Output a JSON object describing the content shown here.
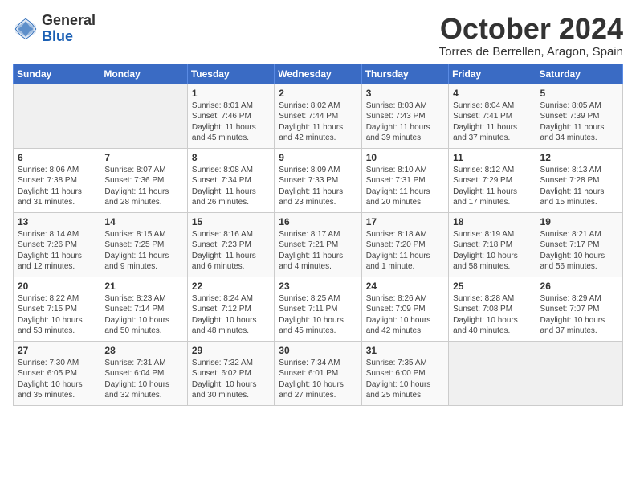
{
  "header": {
    "logo_general": "General",
    "logo_blue": "Blue",
    "month_title": "October 2024",
    "location": "Torres de Berrellen, Aragon, Spain"
  },
  "weekdays": [
    "Sunday",
    "Monday",
    "Tuesday",
    "Wednesday",
    "Thursday",
    "Friday",
    "Saturday"
  ],
  "weeks": [
    [
      {
        "day": "",
        "info": ""
      },
      {
        "day": "",
        "info": ""
      },
      {
        "day": "1",
        "info": "Sunrise: 8:01 AM\nSunset: 7:46 PM\nDaylight: 11 hours and 45 minutes."
      },
      {
        "day": "2",
        "info": "Sunrise: 8:02 AM\nSunset: 7:44 PM\nDaylight: 11 hours and 42 minutes."
      },
      {
        "day": "3",
        "info": "Sunrise: 8:03 AM\nSunset: 7:43 PM\nDaylight: 11 hours and 39 minutes."
      },
      {
        "day": "4",
        "info": "Sunrise: 8:04 AM\nSunset: 7:41 PM\nDaylight: 11 hours and 37 minutes."
      },
      {
        "day": "5",
        "info": "Sunrise: 8:05 AM\nSunset: 7:39 PM\nDaylight: 11 hours and 34 minutes."
      }
    ],
    [
      {
        "day": "6",
        "info": "Sunrise: 8:06 AM\nSunset: 7:38 PM\nDaylight: 11 hours and 31 minutes."
      },
      {
        "day": "7",
        "info": "Sunrise: 8:07 AM\nSunset: 7:36 PM\nDaylight: 11 hours and 28 minutes."
      },
      {
        "day": "8",
        "info": "Sunrise: 8:08 AM\nSunset: 7:34 PM\nDaylight: 11 hours and 26 minutes."
      },
      {
        "day": "9",
        "info": "Sunrise: 8:09 AM\nSunset: 7:33 PM\nDaylight: 11 hours and 23 minutes."
      },
      {
        "day": "10",
        "info": "Sunrise: 8:10 AM\nSunset: 7:31 PM\nDaylight: 11 hours and 20 minutes."
      },
      {
        "day": "11",
        "info": "Sunrise: 8:12 AM\nSunset: 7:29 PM\nDaylight: 11 hours and 17 minutes."
      },
      {
        "day": "12",
        "info": "Sunrise: 8:13 AM\nSunset: 7:28 PM\nDaylight: 11 hours and 15 minutes."
      }
    ],
    [
      {
        "day": "13",
        "info": "Sunrise: 8:14 AM\nSunset: 7:26 PM\nDaylight: 11 hours and 12 minutes."
      },
      {
        "day": "14",
        "info": "Sunrise: 8:15 AM\nSunset: 7:25 PM\nDaylight: 11 hours and 9 minutes."
      },
      {
        "day": "15",
        "info": "Sunrise: 8:16 AM\nSunset: 7:23 PM\nDaylight: 11 hours and 6 minutes."
      },
      {
        "day": "16",
        "info": "Sunrise: 8:17 AM\nSunset: 7:21 PM\nDaylight: 11 hours and 4 minutes."
      },
      {
        "day": "17",
        "info": "Sunrise: 8:18 AM\nSunset: 7:20 PM\nDaylight: 11 hours and 1 minute."
      },
      {
        "day": "18",
        "info": "Sunrise: 8:19 AM\nSunset: 7:18 PM\nDaylight: 10 hours and 58 minutes."
      },
      {
        "day": "19",
        "info": "Sunrise: 8:21 AM\nSunset: 7:17 PM\nDaylight: 10 hours and 56 minutes."
      }
    ],
    [
      {
        "day": "20",
        "info": "Sunrise: 8:22 AM\nSunset: 7:15 PM\nDaylight: 10 hours and 53 minutes."
      },
      {
        "day": "21",
        "info": "Sunrise: 8:23 AM\nSunset: 7:14 PM\nDaylight: 10 hours and 50 minutes."
      },
      {
        "day": "22",
        "info": "Sunrise: 8:24 AM\nSunset: 7:12 PM\nDaylight: 10 hours and 48 minutes."
      },
      {
        "day": "23",
        "info": "Sunrise: 8:25 AM\nSunset: 7:11 PM\nDaylight: 10 hours and 45 minutes."
      },
      {
        "day": "24",
        "info": "Sunrise: 8:26 AM\nSunset: 7:09 PM\nDaylight: 10 hours and 42 minutes."
      },
      {
        "day": "25",
        "info": "Sunrise: 8:28 AM\nSunset: 7:08 PM\nDaylight: 10 hours and 40 minutes."
      },
      {
        "day": "26",
        "info": "Sunrise: 8:29 AM\nSunset: 7:07 PM\nDaylight: 10 hours and 37 minutes."
      }
    ],
    [
      {
        "day": "27",
        "info": "Sunrise: 7:30 AM\nSunset: 6:05 PM\nDaylight: 10 hours and 35 minutes."
      },
      {
        "day": "28",
        "info": "Sunrise: 7:31 AM\nSunset: 6:04 PM\nDaylight: 10 hours and 32 minutes."
      },
      {
        "day": "29",
        "info": "Sunrise: 7:32 AM\nSunset: 6:02 PM\nDaylight: 10 hours and 30 minutes."
      },
      {
        "day": "30",
        "info": "Sunrise: 7:34 AM\nSunset: 6:01 PM\nDaylight: 10 hours and 27 minutes."
      },
      {
        "day": "31",
        "info": "Sunrise: 7:35 AM\nSunset: 6:00 PM\nDaylight: 10 hours and 25 minutes."
      },
      {
        "day": "",
        "info": ""
      },
      {
        "day": "",
        "info": ""
      }
    ]
  ]
}
